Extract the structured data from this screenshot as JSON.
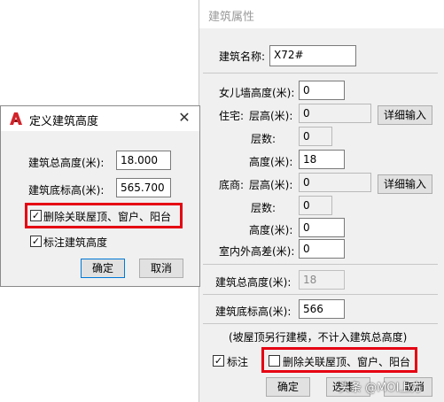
{
  "right_dialog": {
    "title": "建筑属性",
    "building_name_label": "建筑名称:",
    "building_name_value": "X72#",
    "parapet_label": "女儿墙高度(米):",
    "parapet_value": "0",
    "residential_label": "住宅:",
    "res_floor_height_label": "层高(米):",
    "res_floor_height_value": "0",
    "res_detail_button": "详细输入",
    "res_floors_label": "层数:",
    "res_floors_value": "0",
    "res_height_label": "高度(米):",
    "res_height_value": "18",
    "commercial_label": "底商:",
    "com_floor_height_label": "层高(米):",
    "com_floor_height_value": "0",
    "com_detail_button": "详细输入",
    "com_floors_label": "层数:",
    "com_floors_value": "0",
    "com_height_label": "高度(米):",
    "com_height_value": "0",
    "indoor_outdoor_label": "室内外高差(米):",
    "indoor_outdoor_value": "0",
    "total_height_label": "建筑总高度(米):",
    "total_height_value": "18",
    "base_elevation_label": "建筑底标高(米):",
    "base_elevation_value": "566",
    "note": "(坡屋顶另行建模，不计入建筑总高度)",
    "mark_checkbox_label": "标注",
    "mark_checked": true,
    "delete_checkbox_label": "删除关联屋顶、窗户、阳台",
    "delete_checked": false,
    "ok_button": "确定",
    "select_button": "选建",
    "cancel_button": "取消"
  },
  "left_dialog": {
    "title": "定义建筑高度",
    "total_height_label": "建筑总高度(米):",
    "total_height_value": "18.000",
    "base_elevation_label": "建筑底标高(米):",
    "base_elevation_value": "565.700",
    "delete_checkbox_label": "删除关联屋顶、窗户、阳台",
    "delete_checked": true,
    "mark_checkbox_label": "标注建筑高度",
    "mark_checked": true,
    "ok_button": "确定",
    "cancel_button": "取消"
  },
  "watermark": "头条 @MOI上方",
  "colors": {
    "highlight_border": "#e50012",
    "dialog_bg": "#f0f0f0"
  }
}
